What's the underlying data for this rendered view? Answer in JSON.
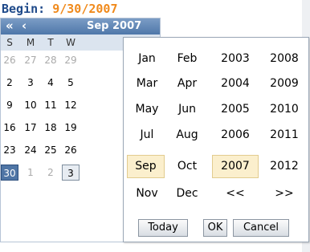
{
  "begin": {
    "label": "Begin:",
    "value": "9/30/2007"
  },
  "calendar": {
    "nav": {
      "prev_year": "«",
      "prev": "‹",
      "next": "›",
      "next_year": "»"
    },
    "title": "Sep 2007",
    "weekdays": [
      "S",
      "M",
      "T",
      "W"
    ],
    "rows": [
      [
        "26",
        "27",
        "28",
        "29"
      ],
      [
        "2",
        "3",
        "4",
        "5"
      ],
      [
        "9",
        "10",
        "11",
        "12"
      ],
      [
        "16",
        "17",
        "18",
        "19"
      ],
      [
        "23",
        "24",
        "25",
        "26"
      ],
      [
        "30",
        "1",
        "2",
        "3"
      ]
    ]
  },
  "picker": {
    "months": [
      "Jan",
      "Feb",
      "Mar",
      "Apr",
      "May",
      "Jun",
      "Jul",
      "Aug",
      "Sep",
      "Oct",
      "Nov",
      "Dec"
    ],
    "years_left": [
      "2003",
      "2004",
      "2005",
      "2006",
      "2007",
      "<<"
    ],
    "years_right": [
      "2008",
      "2009",
      "2010",
      "2011",
      "2012",
      ">>"
    ],
    "selected_month": "Sep",
    "selected_year": "2007",
    "buttons": {
      "today": "Today",
      "ok": "OK",
      "cancel": "Cancel"
    }
  }
}
